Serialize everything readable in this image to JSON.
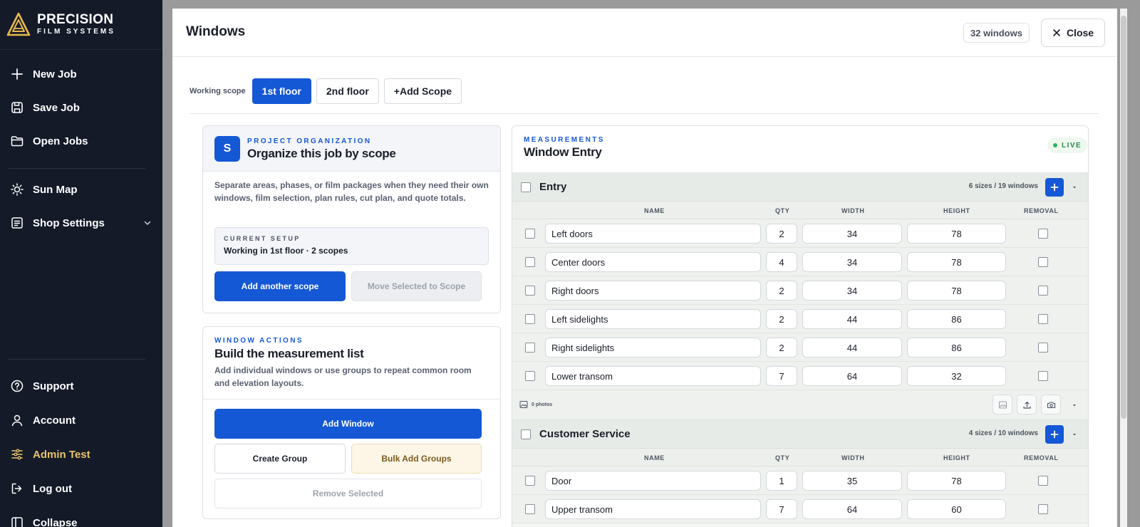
{
  "brand": {
    "name": "PRECISION",
    "sub": "FILM SYSTEMS"
  },
  "nav": {
    "new_job": "New Job",
    "save_job": "Save Job",
    "open_jobs": "Open Jobs",
    "sun_map": "Sun Map",
    "shop_settings": "Shop Settings",
    "support": "Support",
    "account": "Account",
    "admin": "Admin Test",
    "logout": "Log out",
    "collapse": "Collapse"
  },
  "modal": {
    "title": "Windows",
    "count": "32 windows",
    "close_label": "Close"
  },
  "scope": {
    "label": "Working scope",
    "tabs": [
      "1st floor",
      "2nd floor"
    ],
    "add_label": "+Add Scope"
  },
  "org_panel": {
    "badge": "S",
    "eyebrow": "PROJECT ORGANIZATION",
    "title": "Organize this job by scope",
    "description": "Separate areas, phases, or film packages when they need their own windows, film selection, plan rules, cut plan, and quote totals.",
    "setup_eyebrow": "CURRENT SETUP",
    "setup_value": "Working in 1st floor · 2 scopes",
    "add_scope_btn": "Add another scope",
    "move_btn": "Move Selected to Scope"
  },
  "actions_panel": {
    "eyebrow": "WINDOW ACTIONS",
    "title": "Build the measurement list",
    "description": "Add individual windows or use groups to repeat common room and elevation layouts.",
    "add_window_btn": "Add Window",
    "create_group_btn": "Create Group",
    "bulk_add_btn": "Bulk Add Groups",
    "remove_btn": "Remove Selected"
  },
  "measurements": {
    "eyebrow": "MEASUREMENTS",
    "title": "Window Entry",
    "live": "LIVE",
    "columns": {
      "name": "NAME",
      "qty": "QTY",
      "width": "WIDTH",
      "height": "HEIGHT",
      "removal": "REMOVAL"
    },
    "groups": [
      {
        "name": "Entry",
        "count": "6 sizes / 19 windows",
        "photos": "0 photos",
        "rows": [
          {
            "name": "Left doors",
            "qty": "2",
            "width": "34",
            "height": "78"
          },
          {
            "name": "Center doors",
            "qty": "4",
            "width": "34",
            "height": "78"
          },
          {
            "name": "Right doors",
            "qty": "2",
            "width": "34",
            "height": "78"
          },
          {
            "name": "Left sidelights",
            "qty": "2",
            "width": "44",
            "height": "86"
          },
          {
            "name": "Right sidelights",
            "qty": "2",
            "width": "44",
            "height": "86"
          },
          {
            "name": "Lower transom",
            "qty": "7",
            "width": "64",
            "height": "32"
          }
        ]
      },
      {
        "name": "Customer Service",
        "count": "4 sizes / 10 windows",
        "rows": [
          {
            "name": "Door",
            "qty": "1",
            "width": "35",
            "height": "78"
          },
          {
            "name": "Upper transom",
            "qty": "7",
            "width": "64",
            "height": "60"
          }
        ]
      }
    ]
  },
  "colors": {
    "accent": "#1558d6",
    "sidebar": "#141a28",
    "admin": "#e9c46a",
    "live": "#2fb556"
  }
}
